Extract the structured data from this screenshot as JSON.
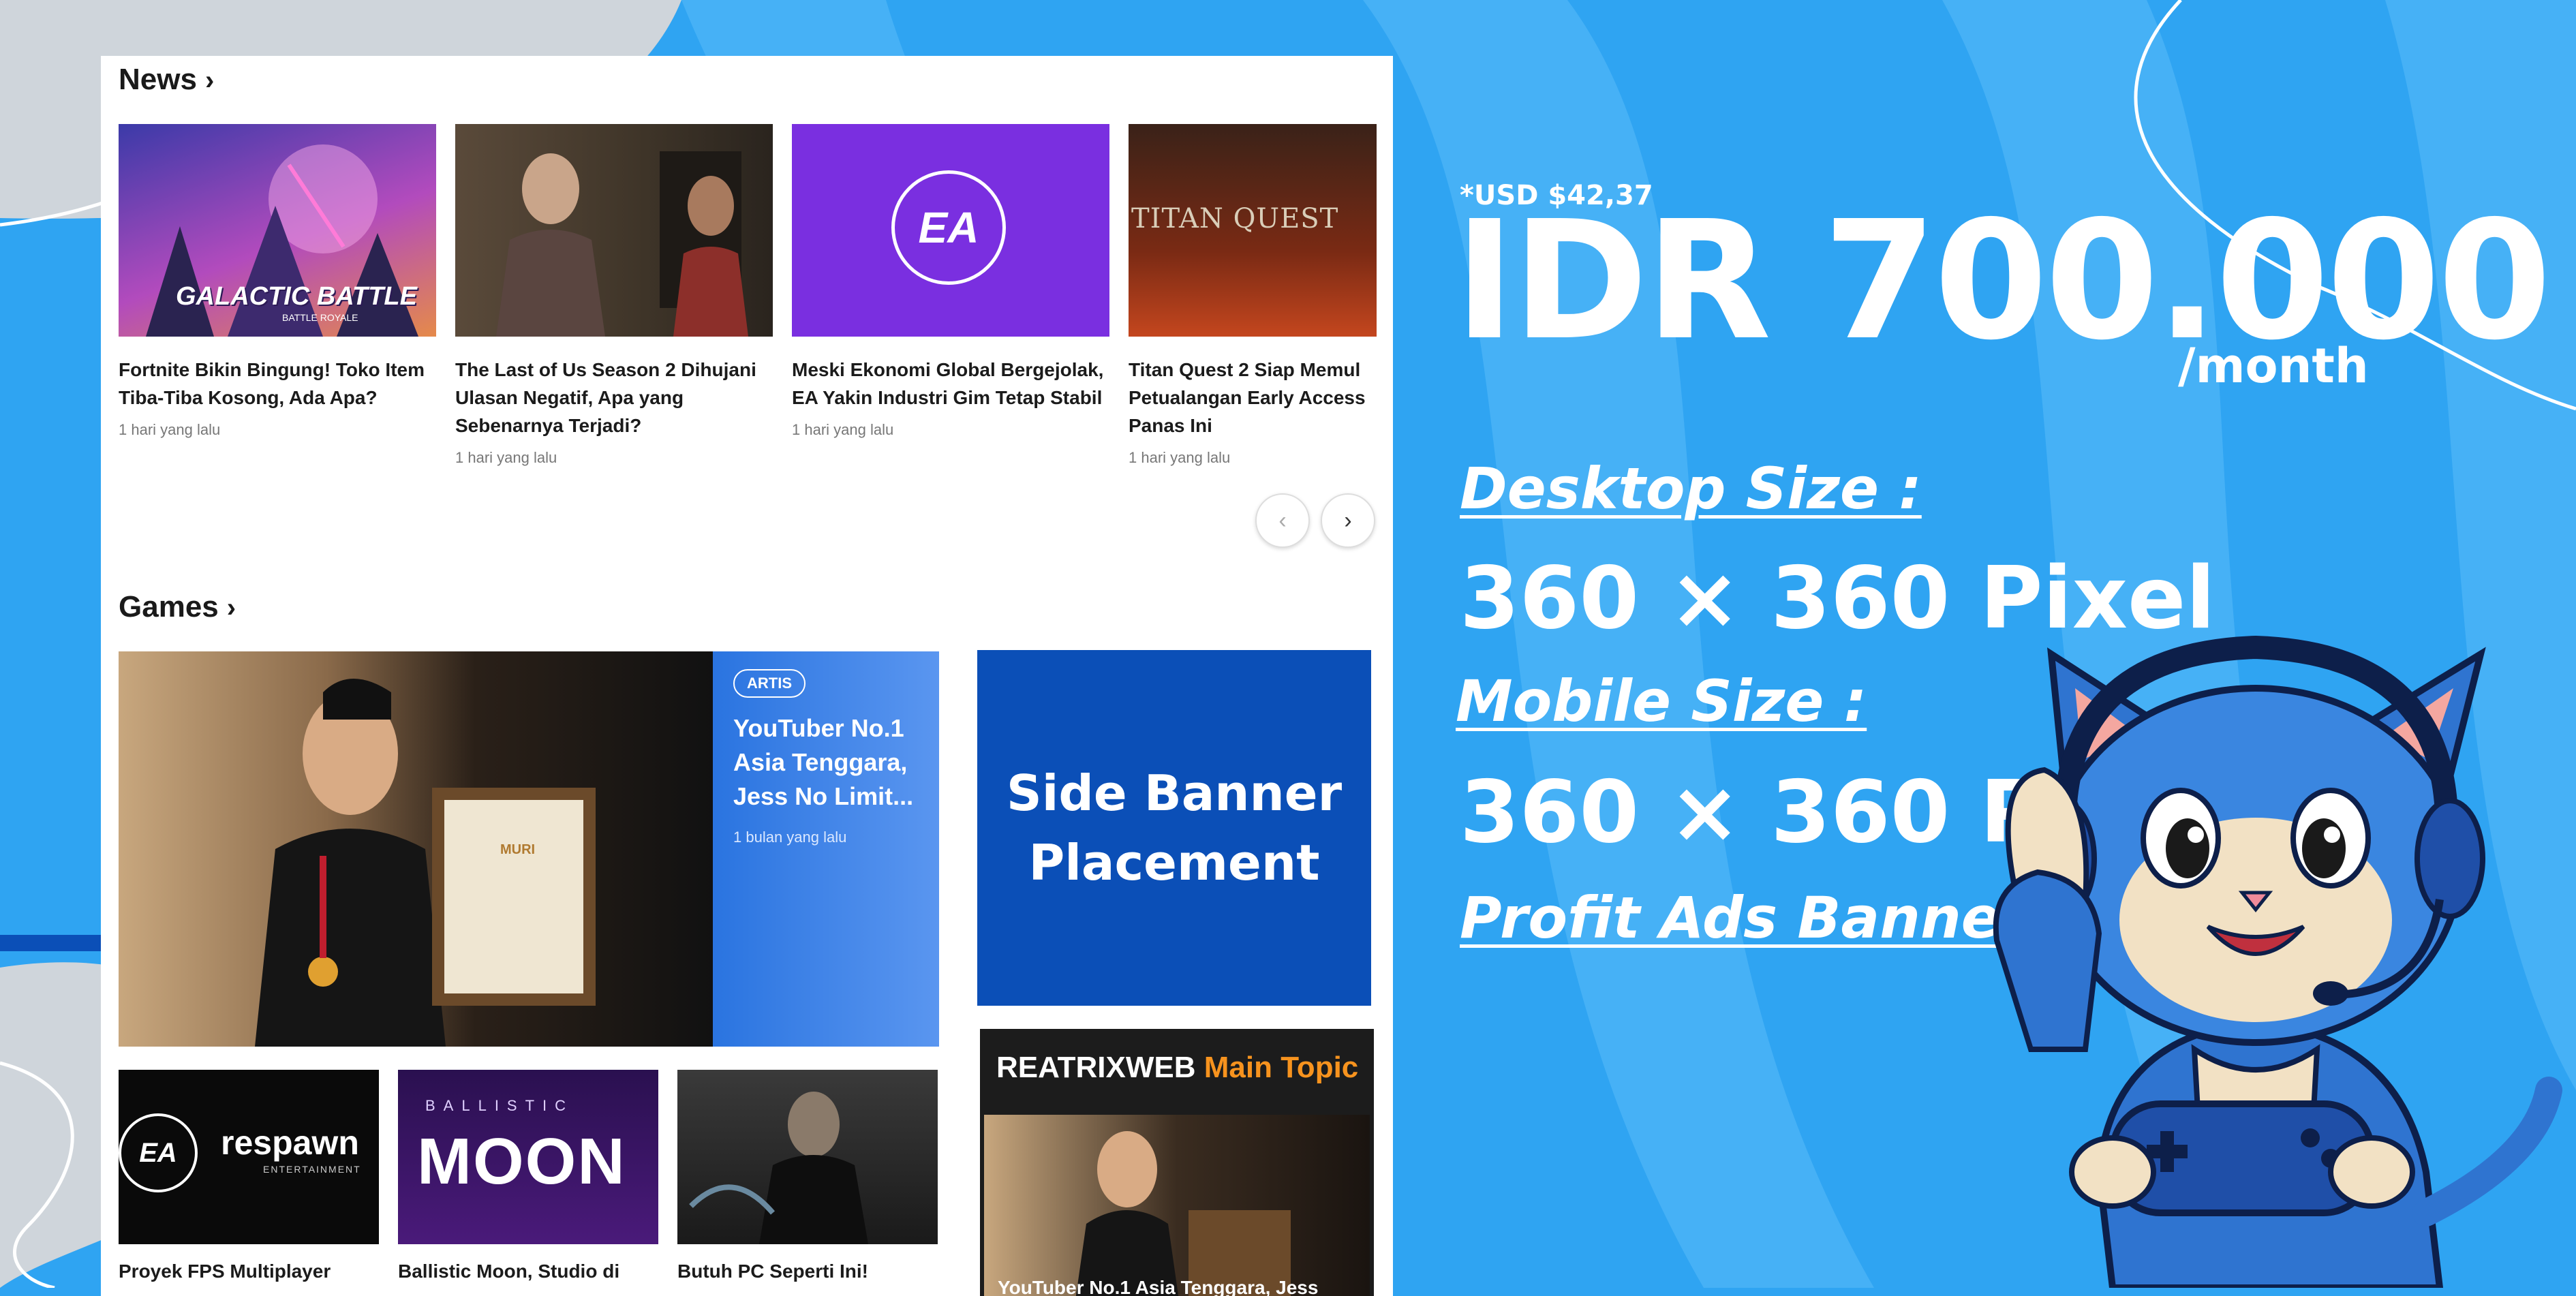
{
  "news": {
    "title": "News",
    "chevron": "›",
    "items": [
      {
        "title": "Fortnite Bikin Bingung! Toko Item Tiba-Tiba Kosong, Ada Apa?",
        "time": "1 hari yang lalu",
        "thumb_text": "GALACTIC BATTLE",
        "thumb_sub": "BATTLE ROYALE"
      },
      {
        "title": "The Last of Us Season 2 Dihujani Ulasan Negatif, Apa yang Sebenarnya Terjadi?",
        "time": "1 hari yang lalu"
      },
      {
        "title": "Meski Ekonomi Global Bergejolak, EA Yakin Industri Gim Tetap Stabil",
        "time": "1 hari yang lalu",
        "thumb_text": "EA"
      },
      {
        "title": "Titan Quest 2 Siap Memul Petualangan Early Access Panas Ini",
        "time": "1 hari yang lalu",
        "thumb_text": "TITAN QUEST"
      }
    ],
    "prev_label": "‹",
    "next_label": "›"
  },
  "games": {
    "title": "Games",
    "chevron": "›",
    "featured": {
      "badge": "ARTIS",
      "title": "YouTuber No.1 Asia Tenggara, Jess No Limit...",
      "time": "1 bulan yang lalu",
      "certificate_text": "MURI"
    },
    "items": [
      {
        "title": "Proyek FPS Multiplayer",
        "thumb_text": "respawn",
        "thumb_sub": "ENTERTAINMENT",
        "logo": "EA"
      },
      {
        "title": "Ballistic Moon, Studio di",
        "thumb_text": "MOON",
        "thumb_sub": "BALLISTIC"
      },
      {
        "title": "Butuh PC Seperti Ini!"
      }
    ]
  },
  "side_banner": {
    "line1": "Side Banner",
    "line2": "Placement"
  },
  "main_topic": {
    "brand": "REATRIXWEB",
    "label": "Main Topic",
    "caption": "YouTuber No.1 Asia Tenggara, Jess"
  },
  "pricing": {
    "usd": "*USD $42,37",
    "price": "IDR 700.000",
    "period": "/month",
    "desktop_label": "Desktop Size :",
    "desktop_size": "360 × 360 Pixel",
    "mobile_label": "Mobile Size :",
    "mobile_size": "360 × 360 Pixel",
    "footer": "Profit Ads Banner"
  },
  "colors": {
    "background": "#2fa4f2",
    "banner_blue": "#0b4fb7",
    "accent_orange": "#f7931e",
    "ea_purple": "#7a2fe0"
  }
}
